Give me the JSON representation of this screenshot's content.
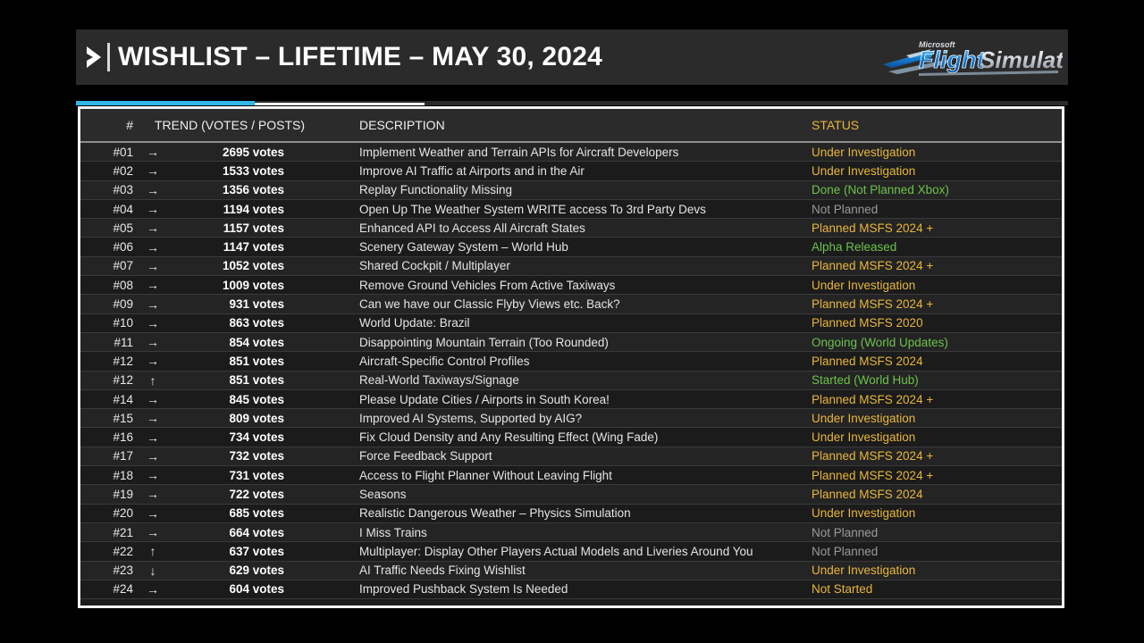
{
  "header": {
    "chevron_icon": "chevron-right-icon",
    "title": "WISHLIST – LIFETIME – MAY 30, 2024",
    "logo_alt": "Microsoft Flight Simulator",
    "logo_brand_small": "Microsoft",
    "logo_brand_main": "Flight Simulator",
    "accent_color": "#30b6e8"
  },
  "table": {
    "columns": {
      "rank": "#",
      "trend": "TREND",
      "trend_sub": "(VOTES / POSTS)",
      "description": "DESCRIPTION",
      "status": "STATUS"
    },
    "status_colors": {
      "gold": "#e8b63a",
      "green": "#6cc24a",
      "gray": "#9a9a9a"
    },
    "rows": [
      {
        "rank": "#01",
        "trend": "→",
        "votes": "2695 votes",
        "description": "Implement Weather and Terrain APIs for Aircraft Developers",
        "status": "Under Investigation",
        "status_class": "st-gold"
      },
      {
        "rank": "#02",
        "trend": "→",
        "votes": "1533 votes",
        "description": "Improve AI Traffic at Airports and in the Air",
        "status": "Under Investigation",
        "status_class": "st-gold"
      },
      {
        "rank": "#03",
        "trend": "→",
        "votes": "1356 votes",
        "description": "Replay Functionality Missing",
        "status": "Done (Not Planned Xbox)",
        "status_class": "st-green"
      },
      {
        "rank": "#04",
        "trend": "→",
        "votes": "1194 votes",
        "description": "Open Up The Weather System WRITE access To 3rd Party Devs",
        "status": "Not Planned",
        "status_class": "st-gray"
      },
      {
        "rank": "#05",
        "trend": "→",
        "votes": "1157 votes",
        "description": "Enhanced API to Access All Aircraft States",
        "status": "Planned MSFS 2024 +",
        "status_class": "st-gold"
      },
      {
        "rank": "#06",
        "trend": "→",
        "votes": "1147 votes",
        "description": "Scenery Gateway System – World Hub",
        "status": "Alpha Released",
        "status_class": "st-green"
      },
      {
        "rank": "#07",
        "trend": "→",
        "votes": "1052 votes",
        "description": "Shared Cockpit / Multiplayer",
        "status": "Planned MSFS 2024 +",
        "status_class": "st-gold"
      },
      {
        "rank": "#08",
        "trend": "→",
        "votes": "1009 votes",
        "description": "Remove Ground Vehicles From Active Taxiways",
        "status": "Under Investigation",
        "status_class": "st-gold"
      },
      {
        "rank": "#09",
        "trend": "→",
        "votes": "931 votes",
        "description": "Can we have our Classic Flyby Views etc. Back?",
        "status": "Planned MSFS 2024 +",
        "status_class": "st-gold"
      },
      {
        "rank": "#10",
        "trend": "→",
        "votes": "863 votes",
        "description": "World Update: Brazil",
        "status": "Planned MSFS 2020",
        "status_class": "st-gold"
      },
      {
        "rank": "#11",
        "trend": "→",
        "votes": "854 votes",
        "description": "Disappointing Mountain Terrain (Too Rounded)",
        "status": "Ongoing (World Updates)",
        "status_class": "st-green"
      },
      {
        "rank": "#12",
        "trend": "→",
        "votes": "851 votes",
        "description": "Aircraft-Specific Control Profiles",
        "status": "Planned MSFS 2024",
        "status_class": "st-gold"
      },
      {
        "rank": "#12",
        "trend": "↑",
        "votes": "851 votes",
        "description": "Real-World Taxiways/Signage",
        "status": "Started (World Hub)",
        "status_class": "st-green"
      },
      {
        "rank": "#14",
        "trend": "→",
        "votes": "845 votes",
        "description": "Please Update Cities / Airports in South Korea!",
        "status": "Planned MSFS 2024 +",
        "status_class": "st-gold"
      },
      {
        "rank": "#15",
        "trend": "→",
        "votes": "809 votes",
        "description": "Improved AI Systems, Supported by AIG?",
        "status": "Under Investigation",
        "status_class": "st-gold"
      },
      {
        "rank": "#16",
        "trend": "→",
        "votes": "734 votes",
        "description": "Fix Cloud Density and Any Resulting Effect (Wing Fade)",
        "status": "Under Investigation",
        "status_class": "st-gold"
      },
      {
        "rank": "#17",
        "trend": "→",
        "votes": "732 votes",
        "description": "Force Feedback Support",
        "status": "Planned MSFS 2024 +",
        "status_class": "st-gold"
      },
      {
        "rank": "#18",
        "trend": "→",
        "votes": "731 votes",
        "description": "Access to Flight Planner Without Leaving Flight",
        "status": "Planned MSFS 2024 +",
        "status_class": "st-gold"
      },
      {
        "rank": "#19",
        "trend": "→",
        "votes": "722 votes",
        "description": "Seasons",
        "status": "Planned MSFS 2024",
        "status_class": "st-gold"
      },
      {
        "rank": "#20",
        "trend": "→",
        "votes": "685 votes",
        "description": "Realistic Dangerous Weather – Physics Simulation",
        "status": "Under Investigation",
        "status_class": "st-gold"
      },
      {
        "rank": "#21",
        "trend": "→",
        "votes": "664 votes",
        "description": "I Miss Trains",
        "status": "Not Planned",
        "status_class": "st-gray"
      },
      {
        "rank": "#22",
        "trend": "↑",
        "votes": "637 votes",
        "description": "Multiplayer: Display Other Players Actual Models and Liveries Around You",
        "status": "Not Planned",
        "status_class": "st-gray"
      },
      {
        "rank": "#23",
        "trend": "↓",
        "votes": "629 votes",
        "description": "AI Traffic Needs Fixing Wishlist",
        "status": "Under Investigation",
        "status_class": "st-gold"
      },
      {
        "rank": "#24",
        "trend": "→",
        "votes": "604 votes",
        "description": "Improved Pushback System Is Needed",
        "status": "Not Started",
        "status_class": "st-gold"
      }
    ]
  }
}
